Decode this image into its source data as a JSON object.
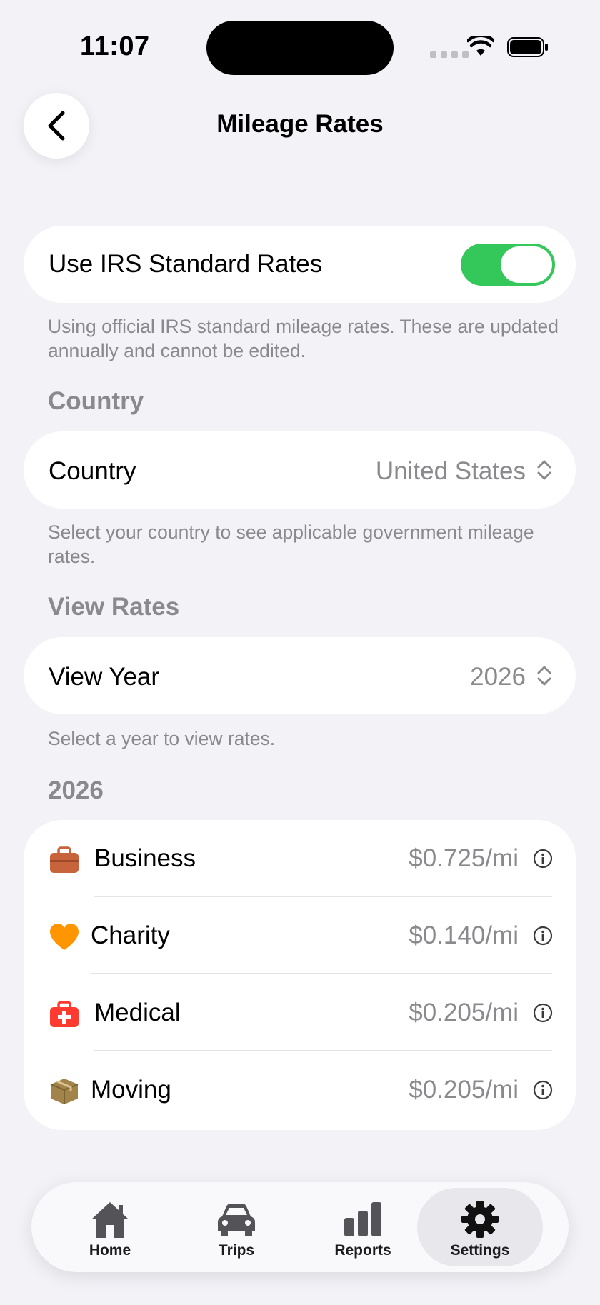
{
  "status_bar": {
    "time": "11:07"
  },
  "nav": {
    "title": "Mileage Rates"
  },
  "irs_toggle": {
    "label": "Use IRS Standard Rates",
    "enabled": true,
    "footnote": "Using official IRS standard mileage rates. These are updated annually and cannot be edited."
  },
  "country_section": {
    "header": "Country",
    "label": "Country",
    "value": "United States",
    "footnote": "Select your country to see applicable government mileage rates."
  },
  "view_rates_section": {
    "header": "View Rates",
    "label": "View Year",
    "value": "2026",
    "footnote": "Select a year to view rates."
  },
  "rates": {
    "header": "2026",
    "items": [
      {
        "name": "Business",
        "value": "$0.725/mi",
        "icon": "briefcase-icon",
        "color": "#c8643c"
      },
      {
        "name": "Charity",
        "value": "$0.140/mi",
        "icon": "heart-icon",
        "color": "#ff9500"
      },
      {
        "name": "Medical",
        "value": "$0.205/mi",
        "icon": "medical-kit-icon",
        "color": "#ff3b30"
      },
      {
        "name": "Moving",
        "value": "$0.205/mi",
        "icon": "box-icon",
        "color": "#a2844a"
      }
    ]
  },
  "tabbar": {
    "items": [
      {
        "label": "Home",
        "icon": "house-icon"
      },
      {
        "label": "Trips",
        "icon": "car-icon"
      },
      {
        "label": "Reports",
        "icon": "bar-chart-icon"
      },
      {
        "label": "Settings",
        "icon": "gear-icon",
        "active": true
      }
    ]
  },
  "colors": {
    "accent_green": "#34c759",
    "background": "#f2f2f7",
    "secondary_text": "#8a8a8e"
  }
}
